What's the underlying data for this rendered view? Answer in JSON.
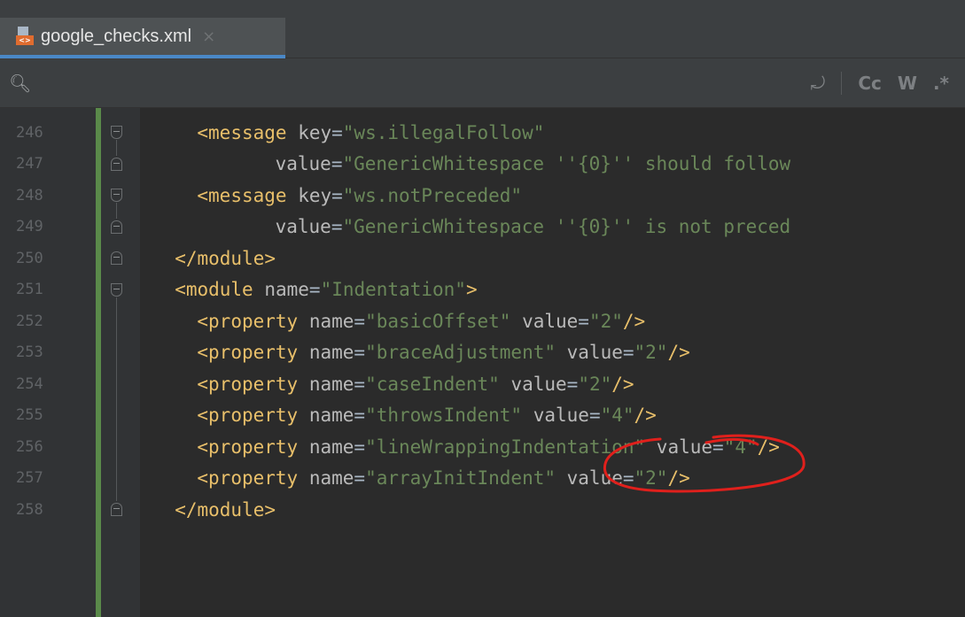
{
  "tab": {
    "filename": "google_checks.xml",
    "close_symbol": "×",
    "icon_badge": "<>"
  },
  "findbar": {
    "search_icon": "magnifier-dropdown-icon",
    "wrap_icon": "⤾",
    "match_case": "Cc",
    "words": "W",
    "regex": ".*"
  },
  "lines": [
    {
      "num": "246",
      "indent": "    ",
      "parts": [
        [
          "tag",
          "<message "
        ],
        [
          "attr",
          "key"
        ],
        [
          "pl",
          "="
        ],
        [
          "str",
          "\"ws.illegalFollow\""
        ]
      ]
    },
    {
      "num": "247",
      "indent": "           ",
      "parts": [
        [
          "attr",
          "value"
        ],
        [
          "pl",
          "="
        ],
        [
          "str",
          "\"GenericWhitespace ''{0}'' should follow"
        ]
      ]
    },
    {
      "num": "248",
      "indent": "    ",
      "parts": [
        [
          "tag",
          "<message "
        ],
        [
          "attr",
          "key"
        ],
        [
          "pl",
          "="
        ],
        [
          "str",
          "\"ws.notPreceded\""
        ]
      ]
    },
    {
      "num": "249",
      "indent": "           ",
      "parts": [
        [
          "attr",
          "value"
        ],
        [
          "pl",
          "="
        ],
        [
          "str",
          "\"GenericWhitespace ''{0}'' is not preced"
        ]
      ]
    },
    {
      "num": "250",
      "indent": "  ",
      "parts": [
        [
          "tag",
          "</module>"
        ]
      ]
    },
    {
      "num": "251",
      "indent": "  ",
      "parts": [
        [
          "tag",
          "<module "
        ],
        [
          "attr",
          "name"
        ],
        [
          "pl",
          "="
        ],
        [
          "str",
          "\"Indentation\""
        ],
        [
          "tag",
          ">"
        ]
      ]
    },
    {
      "num": "252",
      "indent": "    ",
      "parts": [
        [
          "tag",
          "<property "
        ],
        [
          "attr",
          "name"
        ],
        [
          "pl",
          "="
        ],
        [
          "str",
          "\"basicOffset\" "
        ],
        [
          "attr",
          "value"
        ],
        [
          "pl",
          "="
        ],
        [
          "str",
          "\"2\""
        ],
        [
          "tag",
          "/>"
        ]
      ]
    },
    {
      "num": "253",
      "indent": "    ",
      "parts": [
        [
          "tag",
          "<property "
        ],
        [
          "attr",
          "name"
        ],
        [
          "pl",
          "="
        ],
        [
          "str",
          "\"braceAdjustment\" "
        ],
        [
          "attr",
          "value"
        ],
        [
          "pl",
          "="
        ],
        [
          "str",
          "\"2\""
        ],
        [
          "tag",
          "/>"
        ]
      ]
    },
    {
      "num": "254",
      "indent": "    ",
      "parts": [
        [
          "tag",
          "<property "
        ],
        [
          "attr",
          "name"
        ],
        [
          "pl",
          "="
        ],
        [
          "str",
          "\"caseIndent\" "
        ],
        [
          "attr",
          "value"
        ],
        [
          "pl",
          "="
        ],
        [
          "str",
          "\"2\""
        ],
        [
          "tag",
          "/>"
        ]
      ]
    },
    {
      "num": "255",
      "indent": "    ",
      "parts": [
        [
          "tag",
          "<property "
        ],
        [
          "attr",
          "name"
        ],
        [
          "pl",
          "="
        ],
        [
          "str",
          "\"throwsIndent\" "
        ],
        [
          "attr",
          "value"
        ],
        [
          "pl",
          "="
        ],
        [
          "str",
          "\"4\""
        ],
        [
          "tag",
          "/>"
        ]
      ]
    },
    {
      "num": "256",
      "indent": "    ",
      "parts": [
        [
          "tag",
          "<property "
        ],
        [
          "attr",
          "name"
        ],
        [
          "pl",
          "="
        ],
        [
          "str",
          "\"lineWrappingIndentation\" "
        ],
        [
          "attr",
          "value"
        ],
        [
          "pl",
          "="
        ],
        [
          "str",
          "\"4\""
        ],
        [
          "tag",
          "/>"
        ]
      ]
    },
    {
      "num": "257",
      "indent": "    ",
      "parts": [
        [
          "tag",
          "<property "
        ],
        [
          "attr",
          "name"
        ],
        [
          "pl",
          "="
        ],
        [
          "str",
          "\"arrayInitIndent\" "
        ],
        [
          "attr",
          "value"
        ],
        [
          "pl",
          "="
        ],
        [
          "str",
          "\"2\""
        ],
        [
          "tag",
          "/>"
        ]
      ]
    },
    {
      "num": "258",
      "indent": "  ",
      "parts": [
        [
          "tag",
          "</module>"
        ]
      ]
    }
  ],
  "folds": {
    "246": "open",
    "247": "close",
    "248": "open",
    "249": "close",
    "250": "close",
    "251": "open",
    "258": "close"
  },
  "colors": {
    "tag": "#e8bf6a",
    "attribute": "#bababa",
    "string": "#6a8759",
    "annotation": "#e0201c"
  }
}
